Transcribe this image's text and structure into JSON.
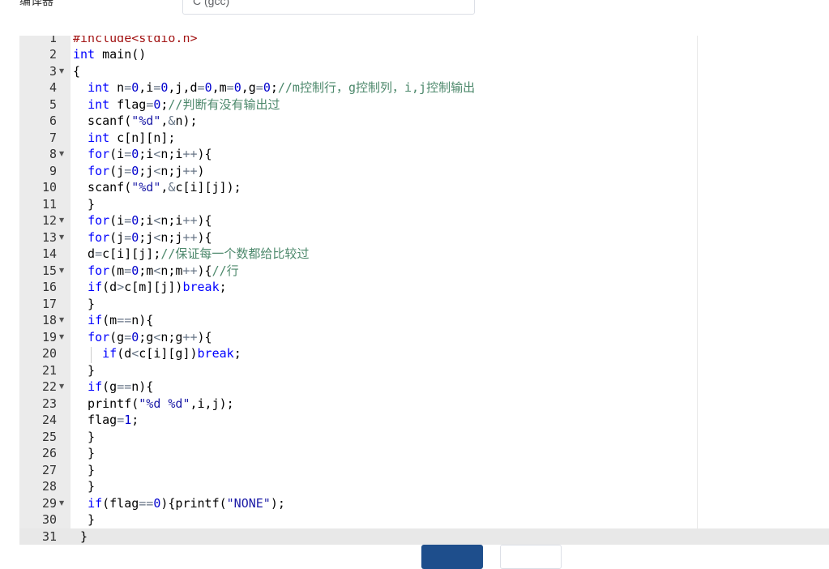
{
  "compiler": {
    "label": "编译器",
    "selected": "C (gcc)"
  },
  "editor": {
    "active_line": 31,
    "lines": [
      {
        "n": "1",
        "fold": false,
        "code": [
          [
            "pp",
            "#include<stdio.h>"
          ]
        ]
      },
      {
        "n": "2",
        "fold": false,
        "code": [
          [
            "kw",
            "int"
          ],
          [
            "",
            " main()"
          ]
        ]
      },
      {
        "n": "3",
        "fold": true,
        "code": [
          [
            "",
            "{"
          ]
        ]
      },
      {
        "n": "4",
        "fold": false,
        "code": [
          [
            "",
            "  "
          ],
          [
            "kw",
            "int"
          ],
          [
            "",
            " n"
          ],
          [
            "op",
            "="
          ],
          [
            "nu",
            "0"
          ],
          [
            "",
            ",i"
          ],
          [
            "op",
            "="
          ],
          [
            "nu",
            "0"
          ],
          [
            "",
            ",j,d"
          ],
          [
            "op",
            "="
          ],
          [
            "nu",
            "0"
          ],
          [
            "",
            ",m"
          ],
          [
            "op",
            "="
          ],
          [
            "nu",
            "0"
          ],
          [
            "",
            ",g"
          ],
          [
            "op",
            "="
          ],
          [
            "nu",
            "0"
          ],
          [
            "",
            ";"
          ],
          [
            "cm",
            "//m控制行，g控制列，i,j控制输出"
          ]
        ]
      },
      {
        "n": "5",
        "fold": false,
        "code": [
          [
            "",
            "  "
          ],
          [
            "kw",
            "int"
          ],
          [
            "",
            " flag"
          ],
          [
            "op",
            "="
          ],
          [
            "nu",
            "0"
          ],
          [
            "",
            ";"
          ],
          [
            "cm",
            "//判断有没有输出过"
          ]
        ]
      },
      {
        "n": "6",
        "fold": false,
        "code": [
          [
            "",
            "  scanf("
          ],
          [
            "st",
            "\"%d\""
          ],
          [
            "",
            ","
          ],
          [
            "op",
            "&"
          ],
          [
            "",
            "n);"
          ]
        ]
      },
      {
        "n": "7",
        "fold": false,
        "code": [
          [
            "",
            "  "
          ],
          [
            "kw",
            "int"
          ],
          [
            "",
            " c[n][n];"
          ]
        ]
      },
      {
        "n": "8",
        "fold": true,
        "code": [
          [
            "",
            "  "
          ],
          [
            "kw",
            "for"
          ],
          [
            "",
            "(i"
          ],
          [
            "op",
            "="
          ],
          [
            "nu",
            "0"
          ],
          [
            "",
            ";i"
          ],
          [
            "op",
            "<"
          ],
          [
            "",
            "n;i"
          ],
          [
            "op",
            "++"
          ],
          [
            "",
            "){"
          ]
        ]
      },
      {
        "n": "9",
        "fold": false,
        "code": [
          [
            "",
            "  "
          ],
          [
            "kw",
            "for"
          ],
          [
            "",
            "(j"
          ],
          [
            "op",
            "="
          ],
          [
            "nu",
            "0"
          ],
          [
            "",
            ";j"
          ],
          [
            "op",
            "<"
          ],
          [
            "",
            "n;j"
          ],
          [
            "op",
            "++"
          ],
          [
            "",
            ")"
          ]
        ]
      },
      {
        "n": "10",
        "fold": false,
        "code": [
          [
            "",
            "  scanf("
          ],
          [
            "st",
            "\"%d\""
          ],
          [
            "",
            ","
          ],
          [
            "op",
            "&"
          ],
          [
            "",
            "c[i][j]);"
          ]
        ]
      },
      {
        "n": "11",
        "fold": false,
        "code": [
          [
            "",
            "  }"
          ]
        ]
      },
      {
        "n": "12",
        "fold": true,
        "code": [
          [
            "",
            "  "
          ],
          [
            "kw",
            "for"
          ],
          [
            "",
            "(i"
          ],
          [
            "op",
            "="
          ],
          [
            "nu",
            "0"
          ],
          [
            "",
            ";i"
          ],
          [
            "op",
            "<"
          ],
          [
            "",
            "n;i"
          ],
          [
            "op",
            "++"
          ],
          [
            "",
            "){"
          ]
        ]
      },
      {
        "n": "13",
        "fold": true,
        "code": [
          [
            "",
            "  "
          ],
          [
            "kw",
            "for"
          ],
          [
            "",
            "(j"
          ],
          [
            "op",
            "="
          ],
          [
            "nu",
            "0"
          ],
          [
            "",
            ";j"
          ],
          [
            "op",
            "<"
          ],
          [
            "",
            "n;j"
          ],
          [
            "op",
            "++"
          ],
          [
            "",
            "){"
          ]
        ]
      },
      {
        "n": "14",
        "fold": false,
        "code": [
          [
            "",
            "  d"
          ],
          [
            "op",
            "="
          ],
          [
            "",
            "c[i][j];"
          ],
          [
            "cm",
            "//保证每一个数都给比较过"
          ]
        ]
      },
      {
        "n": "15",
        "fold": true,
        "code": [
          [
            "",
            "  "
          ],
          [
            "kw",
            "for"
          ],
          [
            "",
            "(m"
          ],
          [
            "op",
            "="
          ],
          [
            "nu",
            "0"
          ],
          [
            "",
            ";m"
          ],
          [
            "op",
            "<"
          ],
          [
            "",
            "n;m"
          ],
          [
            "op",
            "++"
          ],
          [
            "",
            "){"
          ],
          [
            "cm",
            "//行"
          ]
        ]
      },
      {
        "n": "16",
        "fold": false,
        "code": [
          [
            "",
            "  "
          ],
          [
            "kw",
            "if"
          ],
          [
            "",
            "(d"
          ],
          [
            "op",
            ">"
          ],
          [
            "",
            "c[m][j])"
          ],
          [
            "kw",
            "break"
          ],
          [
            "",
            ";"
          ]
        ]
      },
      {
        "n": "17",
        "fold": false,
        "code": [
          [
            "",
            "  }"
          ]
        ]
      },
      {
        "n": "18",
        "fold": true,
        "code": [
          [
            "",
            "  "
          ],
          [
            "kw",
            "if"
          ],
          [
            "",
            "(m"
          ],
          [
            "op",
            "=="
          ],
          [
            "",
            "n){"
          ]
        ]
      },
      {
        "n": "19",
        "fold": true,
        "code": [
          [
            "",
            "  "
          ],
          [
            "kw",
            "for"
          ],
          [
            "",
            "(g"
          ],
          [
            "op",
            "="
          ],
          [
            "nu",
            "0"
          ],
          [
            "",
            ";g"
          ],
          [
            "op",
            "<"
          ],
          [
            "",
            "n;g"
          ],
          [
            "op",
            "++"
          ],
          [
            "",
            "){"
          ]
        ]
      },
      {
        "n": "20",
        "fold": false,
        "code": [
          [
            "",
            "    "
          ],
          [
            "kw",
            "if"
          ],
          [
            "",
            "(d"
          ],
          [
            "op",
            "<"
          ],
          [
            "",
            "c[i][g])"
          ],
          [
            "kw",
            "break"
          ],
          [
            "",
            ";"
          ]
        ]
      },
      {
        "n": "21",
        "fold": false,
        "code": [
          [
            "",
            "  }"
          ]
        ]
      },
      {
        "n": "22",
        "fold": true,
        "code": [
          [
            "",
            "  "
          ],
          [
            "kw",
            "if"
          ],
          [
            "",
            "(g"
          ],
          [
            "op",
            "=="
          ],
          [
            "",
            "n){"
          ]
        ]
      },
      {
        "n": "23",
        "fold": false,
        "code": [
          [
            "",
            "  printf("
          ],
          [
            "st",
            "\"%d %d\""
          ],
          [
            "",
            ",i,j);"
          ]
        ]
      },
      {
        "n": "24",
        "fold": false,
        "code": [
          [
            "",
            "  flag"
          ],
          [
            "op",
            "="
          ],
          [
            "nu",
            "1"
          ],
          [
            "",
            ";"
          ]
        ]
      },
      {
        "n": "25",
        "fold": false,
        "code": [
          [
            "",
            "  }"
          ]
        ]
      },
      {
        "n": "26",
        "fold": false,
        "code": [
          [
            "",
            "  }"
          ]
        ]
      },
      {
        "n": "27",
        "fold": false,
        "code": [
          [
            "",
            "  }"
          ]
        ]
      },
      {
        "n": "28",
        "fold": false,
        "code": [
          [
            "",
            "  }"
          ]
        ]
      },
      {
        "n": "29",
        "fold": true,
        "code": [
          [
            "",
            "  "
          ],
          [
            "kw",
            "if"
          ],
          [
            "",
            "(flag"
          ],
          [
            "op",
            "=="
          ],
          [
            "nu",
            "0"
          ],
          [
            "",
            "){printf("
          ],
          [
            "st",
            "\"NONE\""
          ],
          [
            "",
            ");"
          ]
        ]
      },
      {
        "n": "30",
        "fold": false,
        "code": [
          [
            "",
            "  }"
          ]
        ]
      },
      {
        "n": "31",
        "fold": false,
        "code": [
          [
            "",
            " }"
          ]
        ]
      }
    ]
  },
  "colors": {
    "primary_button": "#1e4e8c",
    "gutter": "#ebebeb",
    "keyword": "#0000ff",
    "comment": "#4c886b"
  }
}
